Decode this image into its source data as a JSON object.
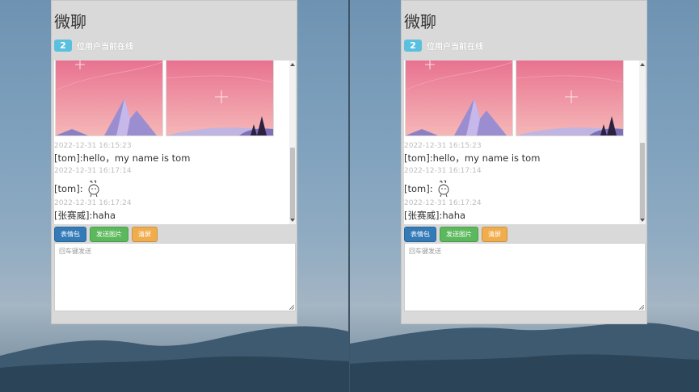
{
  "app": {
    "title": "微聊",
    "online_count": "2",
    "online_text": "位用户当前在线"
  },
  "messages": [
    {
      "time": "2022-12-31 16:15:23",
      "sender": "[tom]",
      "sep": " : ",
      "text": "hello，my name is tom"
    },
    {
      "time": "2022-12-31 16:17:14",
      "sender": "[tom]",
      "sep": " : ",
      "text": ""
    },
    {
      "time": "2022-12-31 16:17:24",
      "sender": "[张赛威]",
      "sep": " : ",
      "text": "haha"
    }
  ],
  "toolbar": {
    "emoji_label": "表情包",
    "send_image_label": "发送图片",
    "clear_label": "清屏"
  },
  "input": {
    "placeholder": "回车键发送"
  },
  "colors": {
    "badge": "#5bc0de",
    "btn_emoji": "#337ab7",
    "btn_image": "#5cb85c",
    "btn_clear": "#f0ad4e"
  },
  "icons": {
    "sticker": "rabbit-sticker-icon"
  }
}
